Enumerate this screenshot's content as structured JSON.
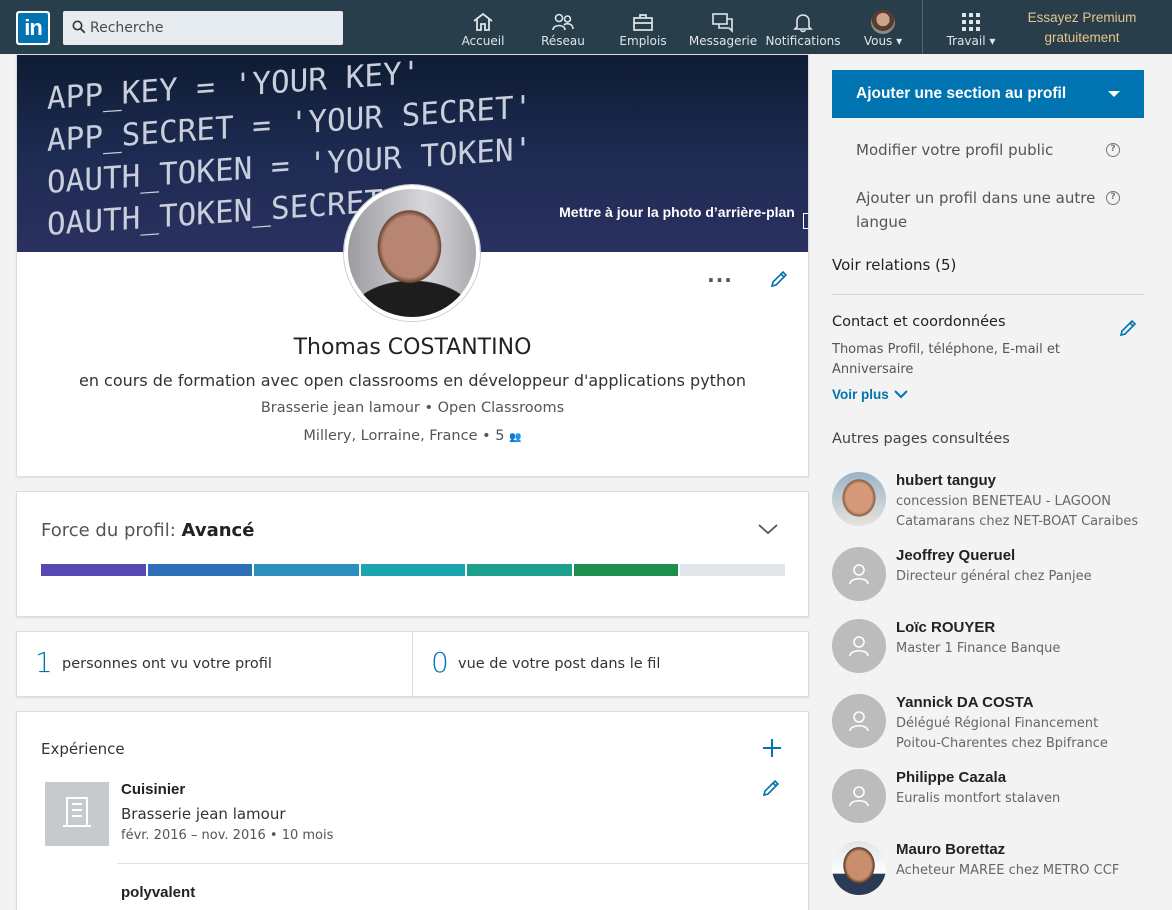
{
  "nav": {
    "search_placeholder": "Recherche",
    "items": [
      {
        "label": "Accueil",
        "icon": "home-icon"
      },
      {
        "label": "Réseau",
        "icon": "network-icon"
      },
      {
        "label": "Emplois",
        "icon": "briefcase-icon"
      },
      {
        "label": "Messagerie",
        "icon": "messaging-icon"
      },
      {
        "label": "Notifications",
        "icon": "bell-icon"
      },
      {
        "label": "Vous ▾",
        "icon": "user-avatar"
      },
      {
        "label": "Travail ▾",
        "icon": "grid-icon"
      }
    ],
    "premium": "Essayez Premium gratuitement"
  },
  "profile": {
    "banner_code": [
      "APP_KEY = 'YOUR KEY'",
      "APP_SECRET = 'YOUR SECRET'",
      "OAUTH_TOKEN = 'YOUR TOKEN'",
      "OAUTH_TOKEN_SECRET"
    ],
    "banner_update": "Mettre à jour la photo d’arrière-plan",
    "name": "Thomas COSTANTINO",
    "headline": "en cours de formation avec open classrooms en développeur d'applications python",
    "work": "Brasserie jean lamour • Open Classrooms",
    "location": "Millery, Lorraine, France • 5"
  },
  "strength": {
    "label": "Force du profil: ",
    "level": "Avancé",
    "filled_segments": 6,
    "total_segments": 7,
    "colors": [
      "#5548b2",
      "#2d6eb8",
      "#2a8fbd",
      "#1aa5b0",
      "#1c9f8b",
      "#1f8e4d",
      "#e1e6ea"
    ]
  },
  "stats": [
    {
      "num": "1",
      "label": "personnes ont vu votre profil"
    },
    {
      "num": "0",
      "label": "vue de votre post dans le fil"
    }
  ],
  "experience": {
    "title": "Expérience",
    "items": [
      {
        "role": "Cuisinier",
        "company": "Brasserie jean lamour",
        "dates": "févr. 2016 – nov. 2016   • 10 mois"
      },
      {
        "role": "polyvalent"
      }
    ]
  },
  "sidebar": {
    "add_section": "Ajouter une section au profil",
    "edit_public": "Modifier votre profil public",
    "add_language": "Ajouter un profil dans une autre langue",
    "relations": "Voir relations (5)",
    "contact_title": "Contact et coordonnées",
    "contact_desc": "Thomas Profil, téléphone, E-mail et Anniversaire",
    "see_more": "Voir plus",
    "other_pages": "Autres pages consultées",
    "people": [
      {
        "name": "hubert tanguy",
        "desc": "concession BENETEAU - LAGOON Catamarans chez NET-BOAT Caraibes"
      },
      {
        "name": "Jeoffrey Queruel",
        "desc": "Directeur général chez Panjee"
      },
      {
        "name": "Loïc ROUYER",
        "desc": "Master 1 Finance Banque"
      },
      {
        "name": "Yannick DA COSTA",
        "desc": "Délégué Régional Financement Poitou-Charentes chez Bpifrance"
      },
      {
        "name": "Philippe Cazala",
        "desc": "Euralis montfort stalaven"
      },
      {
        "name": "Mauro Borettaz",
        "desc": "Acheteur MAREE chez METRO CCF"
      }
    ]
  },
  "colors": {
    "nav_bg": "#283e4a",
    "brand_blue": "#0073b1",
    "premium_gold": "#e7c58b"
  }
}
